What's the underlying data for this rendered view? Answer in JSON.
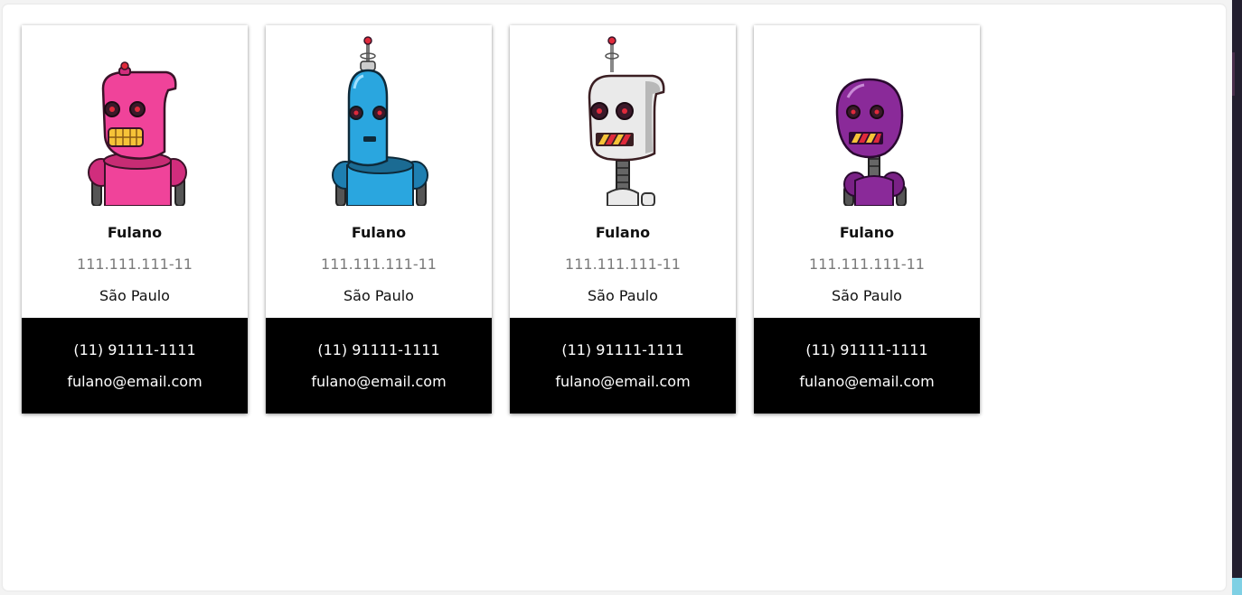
{
  "cards": [
    {
      "name": "Fulano",
      "cpf": "111.111.111-11",
      "city": "São Paulo",
      "phone": "(11) 91111-1111",
      "email": "fulano@email.com",
      "avatar_icon": "pink-robot-icon",
      "color": "#f0439a"
    },
    {
      "name": "Fulano",
      "cpf": "111.111.111-11",
      "city": "São Paulo",
      "phone": "(11) 91111-1111",
      "email": "fulano@email.com",
      "avatar_icon": "blue-robot-icon",
      "color": "#2aa6df"
    },
    {
      "name": "Fulano",
      "cpf": "111.111.111-11",
      "city": "São Paulo",
      "phone": "(11) 91111-1111",
      "email": "fulano@email.com",
      "avatar_icon": "white-robot-icon",
      "color": "#e9e9e9"
    },
    {
      "name": "Fulano",
      "cpf": "111.111.111-11",
      "city": "São Paulo",
      "phone": "(11) 91111-1111",
      "email": "fulano@email.com",
      "avatar_icon": "purple-robot-icon",
      "color": "#8a2a99"
    }
  ]
}
